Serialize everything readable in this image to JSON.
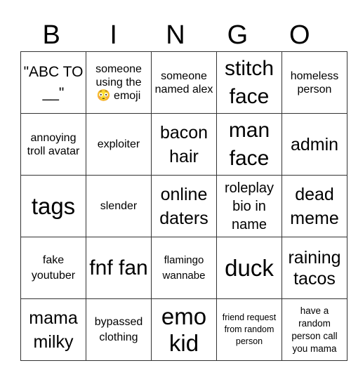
{
  "header": [
    "B",
    "I",
    "N",
    "G",
    "O"
  ],
  "cells": [
    [
      "\"ABC TO __\"",
      "someone using the 😳 emoji",
      "someone named alex",
      "stitch face",
      "homeless person"
    ],
    [
      "annoying troll avatar",
      "exploiter",
      "bacon hair",
      "man face",
      "admin"
    ],
    [
      "tags",
      "slender",
      "online daters",
      "roleplay bio in name",
      "dead meme"
    ],
    [
      "fake youtuber",
      "fnf fan",
      "flamingo wannabe",
      "duck",
      "raining tacos"
    ],
    [
      "mama milky",
      "bypassed clothing",
      "emo kid",
      "friend request from random person",
      "have a random person call you mama"
    ]
  ]
}
